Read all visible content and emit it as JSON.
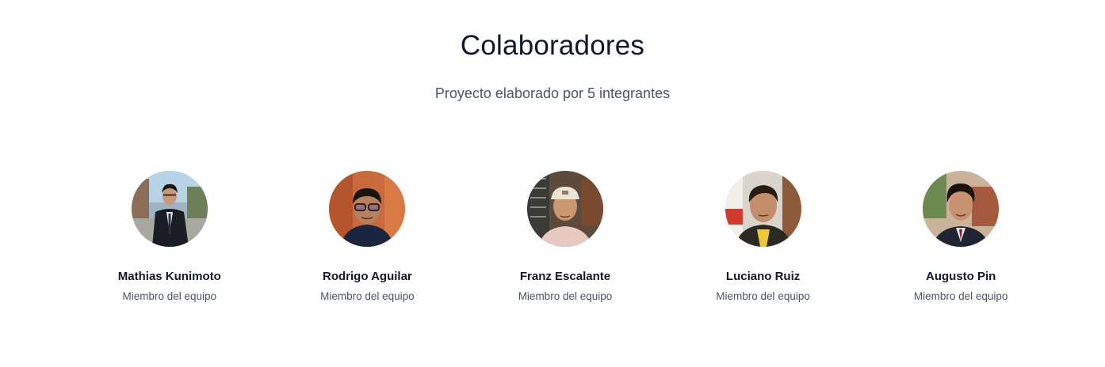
{
  "section": {
    "title": "Colaboradores",
    "subtitle": "Proyecto elaborado por 5 integrantes"
  },
  "members": [
    {
      "name": "Mathias Kunimoto",
      "role": "Miembro del equipo",
      "avatar": "photo-portrait"
    },
    {
      "name": "Rodrigo Aguilar",
      "role": "Miembro del equipo",
      "avatar": "photo-portrait"
    },
    {
      "name": "Franz Escalante",
      "role": "Miembro del equipo",
      "avatar": "photo-portrait"
    },
    {
      "name": "Luciano Ruiz",
      "role": "Miembro del equipo",
      "avatar": "photo-portrait"
    },
    {
      "name": "Augusto Pin",
      "role": "Miembro del equipo",
      "avatar": "photo-portrait"
    }
  ],
  "colors": {
    "title": "#0f172a",
    "text": "#4b5563",
    "background": "#ffffff"
  }
}
